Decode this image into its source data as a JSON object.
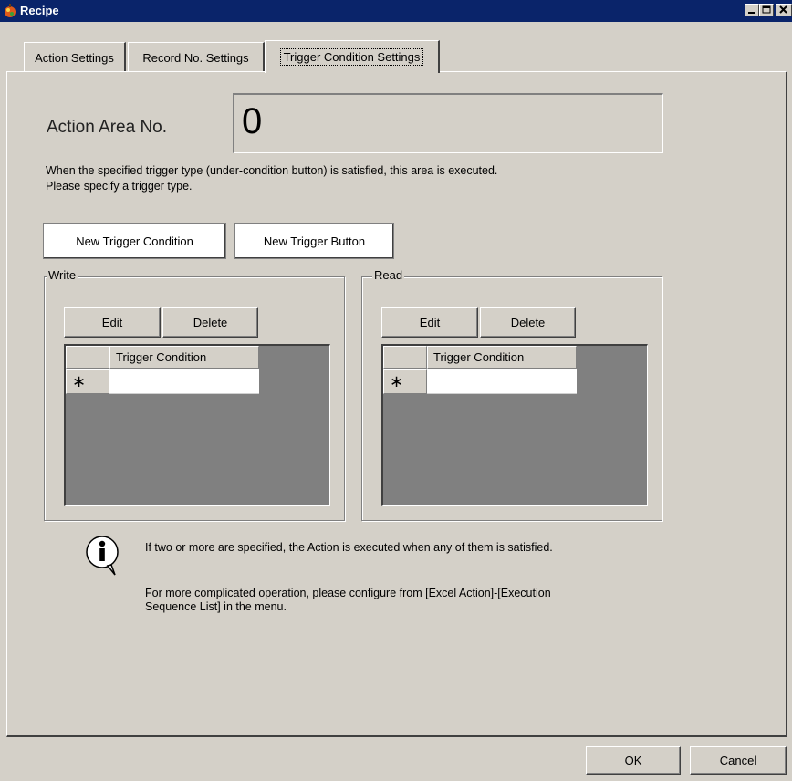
{
  "window": {
    "title": "Recipe",
    "app_icon": "recipe-app-icon",
    "controls": [
      "minimize-icon",
      "maximize-icon",
      "close-icon"
    ]
  },
  "tabs": [
    {
      "label": "Action Settings",
      "active": false
    },
    {
      "label": "Record No. Settings",
      "active": false
    },
    {
      "label": "Trigger Condition Settings",
      "active": true
    }
  ],
  "action_area": {
    "label": "Action Area No.",
    "value": "0"
  },
  "description": {
    "line1": "When the specified trigger type (under-condition button) is satisfied, this area is executed.",
    "line2": "Please specify a trigger type."
  },
  "buttons": {
    "new_trigger_condition": "New Trigger Condition",
    "new_trigger_button": "New Trigger Button"
  },
  "write_group": {
    "label": "Write",
    "edit": "Edit",
    "delete": "Delete",
    "column_header": "Trigger Condition",
    "new_row_marker": "∗",
    "new_row_value": ""
  },
  "read_group": {
    "label": "Read",
    "edit": "Edit",
    "delete": "Delete",
    "column_header": "Trigger Condition",
    "new_row_marker": "∗",
    "new_row_value": ""
  },
  "info": {
    "icon": "info-icon",
    "line1": "If two or more are specified, the Action is executed when any of them is satisfied.",
    "line2": "For more complicated operation, please configure from [Excel Action]-[Execution",
    "line3": "Sequence List] in the menu."
  },
  "footer": {
    "ok": "OK",
    "cancel": "Cancel"
  },
  "colors": {
    "titlebar": "#0a246a",
    "face": "#d4d0c8",
    "grid_background": "#808080"
  }
}
